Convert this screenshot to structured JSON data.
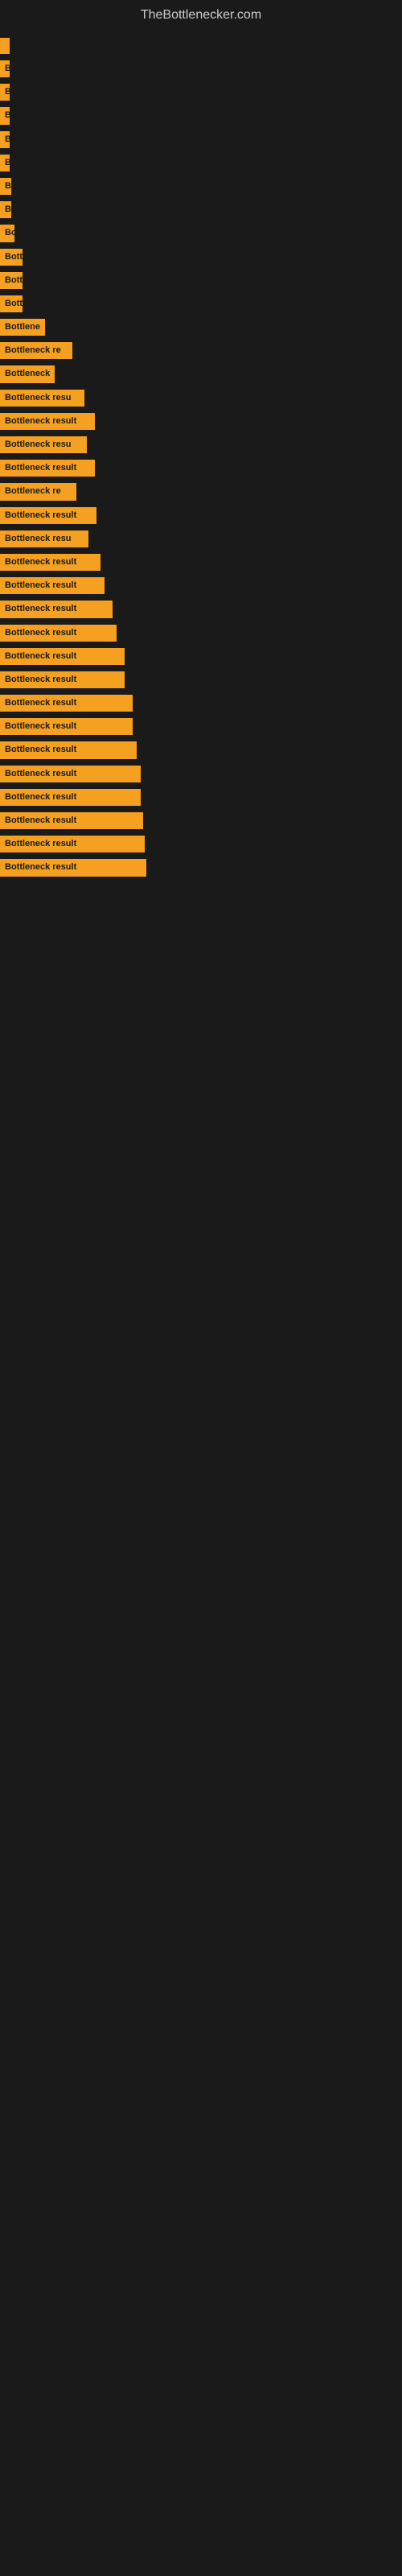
{
  "site": {
    "title": "TheBottlenecker.com"
  },
  "bars": [
    {
      "label": "",
      "width": 8,
      "visible_text": ""
    },
    {
      "label": "B",
      "width": 12,
      "visible_text": "B"
    },
    {
      "label": "B",
      "width": 12,
      "visible_text": "B"
    },
    {
      "label": "B",
      "width": 12,
      "visible_text": "B"
    },
    {
      "label": "B",
      "width": 12,
      "visible_text": "B"
    },
    {
      "label": "B",
      "width": 12,
      "visible_text": "B"
    },
    {
      "label": "B",
      "width": 14,
      "visible_text": "B"
    },
    {
      "label": "B",
      "width": 14,
      "visible_text": "B"
    },
    {
      "label": "Bo",
      "width": 18,
      "visible_text": "Bo"
    },
    {
      "label": "Bott",
      "width": 28,
      "visible_text": "Bott"
    },
    {
      "label": "Bott",
      "width": 28,
      "visible_text": "Bott"
    },
    {
      "label": "Bott",
      "width": 28,
      "visible_text": "Bott"
    },
    {
      "label": "Bottlene",
      "width": 56,
      "visible_text": "Bottlene"
    },
    {
      "label": "Bottleneck re",
      "width": 90,
      "visible_text": "Bottleneck re"
    },
    {
      "label": "Bottleneck",
      "width": 68,
      "visible_text": "Bottleneck"
    },
    {
      "label": "Bottleneck resu",
      "width": 105,
      "visible_text": "Bottleneck resu"
    },
    {
      "label": "Bottleneck result",
      "width": 118,
      "visible_text": "Bottleneck result"
    },
    {
      "label": "Bottleneck resu",
      "width": 108,
      "visible_text": "Bottleneck resu"
    },
    {
      "label": "Bottleneck result",
      "width": 118,
      "visible_text": "Bottleneck result"
    },
    {
      "label": "Bottleneck re",
      "width": 95,
      "visible_text": "Bottleneck re"
    },
    {
      "label": "Bottleneck result",
      "width": 120,
      "visible_text": "Bottleneck result"
    },
    {
      "label": "Bottleneck resu",
      "width": 110,
      "visible_text": "Bottleneck resu"
    },
    {
      "label": "Bottleneck result",
      "width": 125,
      "visible_text": "Bottleneck result"
    },
    {
      "label": "Bottleneck result",
      "width": 130,
      "visible_text": "Bottleneck result"
    },
    {
      "label": "Bottleneck result",
      "width": 140,
      "visible_text": "Bottleneck result"
    },
    {
      "label": "Bottleneck result",
      "width": 145,
      "visible_text": "Bottleneck result"
    },
    {
      "label": "Bottleneck result",
      "width": 155,
      "visible_text": "Bottleneck result"
    },
    {
      "label": "Bottleneck result",
      "width": 155,
      "visible_text": "Bottleneck result"
    },
    {
      "label": "Bottleneck result",
      "width": 165,
      "visible_text": "Bottleneck result"
    },
    {
      "label": "Bottleneck result",
      "width": 165,
      "visible_text": "Bottleneck result"
    },
    {
      "label": "Bottleneck result",
      "width": 170,
      "visible_text": "Bottleneck result"
    },
    {
      "label": "Bottleneck result",
      "width": 175,
      "visible_text": "Bottleneck result"
    },
    {
      "label": "Bottleneck result",
      "width": 175,
      "visible_text": "Bottleneck result"
    },
    {
      "label": "Bottleneck result",
      "width": 178,
      "visible_text": "Bottleneck result"
    },
    {
      "label": "Bottleneck result",
      "width": 180,
      "visible_text": "Bottleneck result"
    },
    {
      "label": "Bottleneck result",
      "width": 182,
      "visible_text": "Bottleneck result"
    }
  ]
}
